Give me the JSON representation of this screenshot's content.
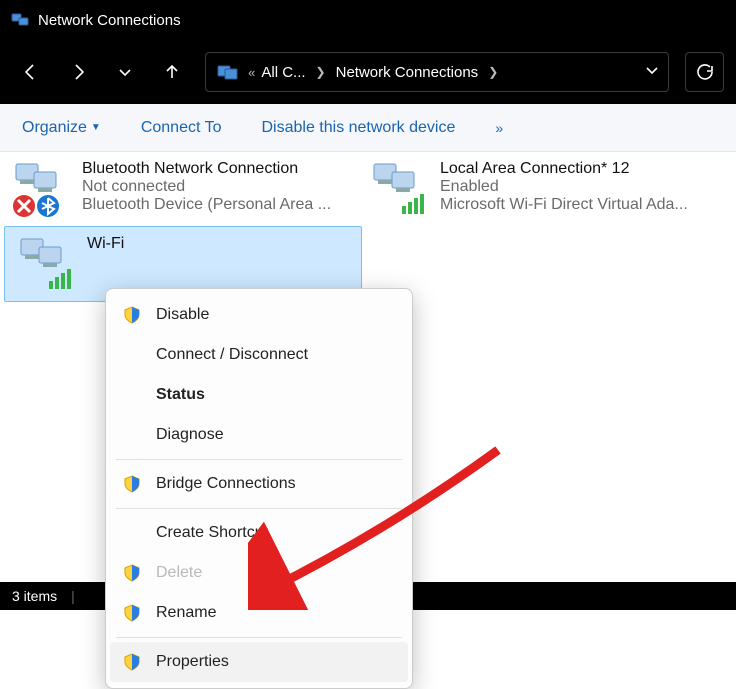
{
  "window": {
    "title": "Network Connections"
  },
  "nav": {
    "segment1": "All C...",
    "segment2": "Network Connections"
  },
  "toolbar": {
    "organize": "Organize",
    "connect_to": "Connect To",
    "disable": "Disable this network device",
    "more": "»"
  },
  "connections": [
    {
      "name": "Bluetooth Network Connection",
      "status": "Not connected",
      "device": "Bluetooth Device (Personal Area ..."
    },
    {
      "name": "Local Area Connection* 12",
      "status": "Enabled",
      "device": "Microsoft Wi-Fi Direct Virtual Ada..."
    },
    {
      "name": "Wi-Fi",
      "status": "",
      "device": ""
    }
  ],
  "context_menu": {
    "items": [
      {
        "label": "Disable",
        "shield": true
      },
      {
        "label": "Connect / Disconnect"
      },
      {
        "label": "Status",
        "bold": true
      },
      {
        "label": "Diagnose"
      },
      {
        "sep": true
      },
      {
        "label": "Bridge Connections",
        "shield": true
      },
      {
        "sep": true
      },
      {
        "label": "Create Shortcut"
      },
      {
        "label": "Delete",
        "shield": true,
        "disabled": true
      },
      {
        "label": "Rename",
        "shield": true
      },
      {
        "sep": true
      },
      {
        "label": "Properties",
        "shield": true,
        "hover": true
      }
    ]
  },
  "statusbar": {
    "count_text": "3 items"
  }
}
